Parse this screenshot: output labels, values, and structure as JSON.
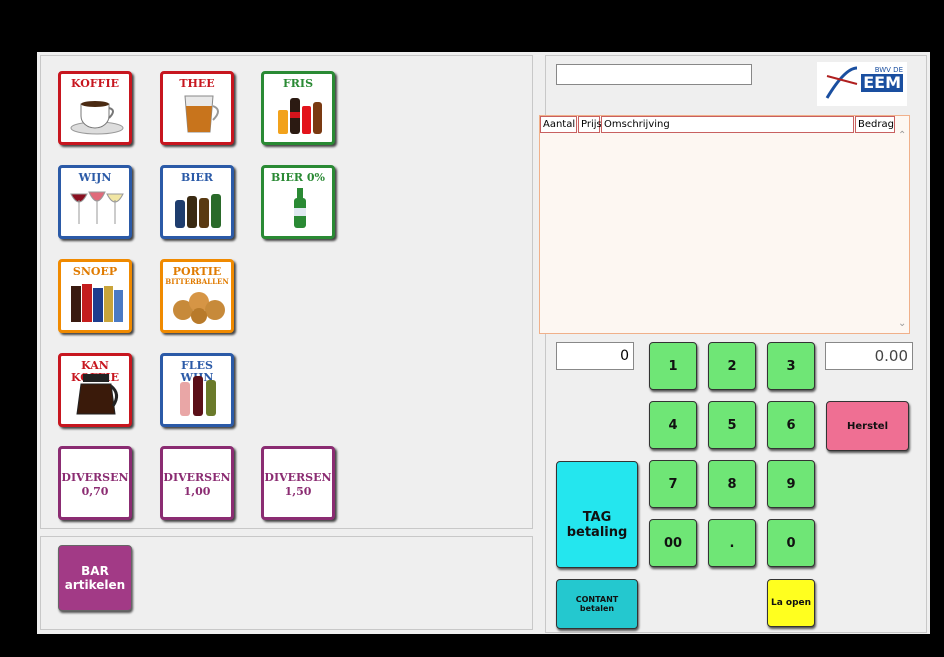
{
  "tiles": [
    {
      "label": "KOFFIE",
      "sub": "",
      "color": "red",
      "icon": "coffee-cup-icon"
    },
    {
      "label": "THEE",
      "sub": "",
      "color": "red",
      "icon": "tea-glass-icon"
    },
    {
      "label": "FRIS",
      "sub": "",
      "color": "green",
      "icon": "soda-bottles-icon"
    },
    {
      "label": "WIJN",
      "sub": "",
      "color": "blue",
      "icon": "wine-glasses-icon"
    },
    {
      "label": "BIER",
      "sub": "",
      "color": "blue",
      "icon": "beer-bottles-icon"
    },
    {
      "label": "BIER 0%",
      "sub": "",
      "color": "green",
      "icon": "beer-bottle-icon"
    },
    {
      "label": "SNOEP",
      "sub": "",
      "color": "orange",
      "icon": "candy-bars-icon"
    },
    {
      "label": "PORTIE",
      "sub": "BITTERBALLEN",
      "color": "orange",
      "icon": "bitterballen-icon"
    },
    {
      "label": "KAN KOFFIE",
      "sub": "",
      "color": "red",
      "icon": "coffee-pot-icon"
    },
    {
      "label": "FLES WIJN",
      "sub": "",
      "color": "blue",
      "icon": "wine-bottles-icon"
    },
    {
      "label": "DIVERSEN",
      "sub": "0,70",
      "color": "purple",
      "icon": ""
    },
    {
      "label": "DIVERSEN",
      "sub": "1,00",
      "color": "purple",
      "icon": ""
    },
    {
      "label": "DIVERSEN",
      "sub": "1,50",
      "color": "purple",
      "icon": ""
    }
  ],
  "bar_button": {
    "line1": "BAR",
    "line2": "artikelen"
  },
  "logo": {
    "top": "BWV DE",
    "main": "EEM"
  },
  "order_table": {
    "columns": [
      "Aantal",
      "Prijs",
      "Omschrijving",
      "Bedrag"
    ]
  },
  "quantity_value": "0",
  "amount_value": "0.00",
  "keypad": [
    "1",
    "2",
    "3",
    "4",
    "5",
    "6",
    "7",
    "8",
    "9",
    "00",
    ".",
    "0"
  ],
  "buttons": {
    "herstel": "Herstel",
    "tag_line1": "TAG",
    "tag_line2": "betaling",
    "contant_line1": "CONTANT",
    "contant_line2": "betalen",
    "la_open": "La open"
  },
  "colors": {
    "keypad": "#6fe676",
    "herstel": "#ef6f93",
    "tag": "#24e6ee",
    "contant": "#24c8cf",
    "la_open": "#ffff1f",
    "bar": "#a23a86"
  }
}
